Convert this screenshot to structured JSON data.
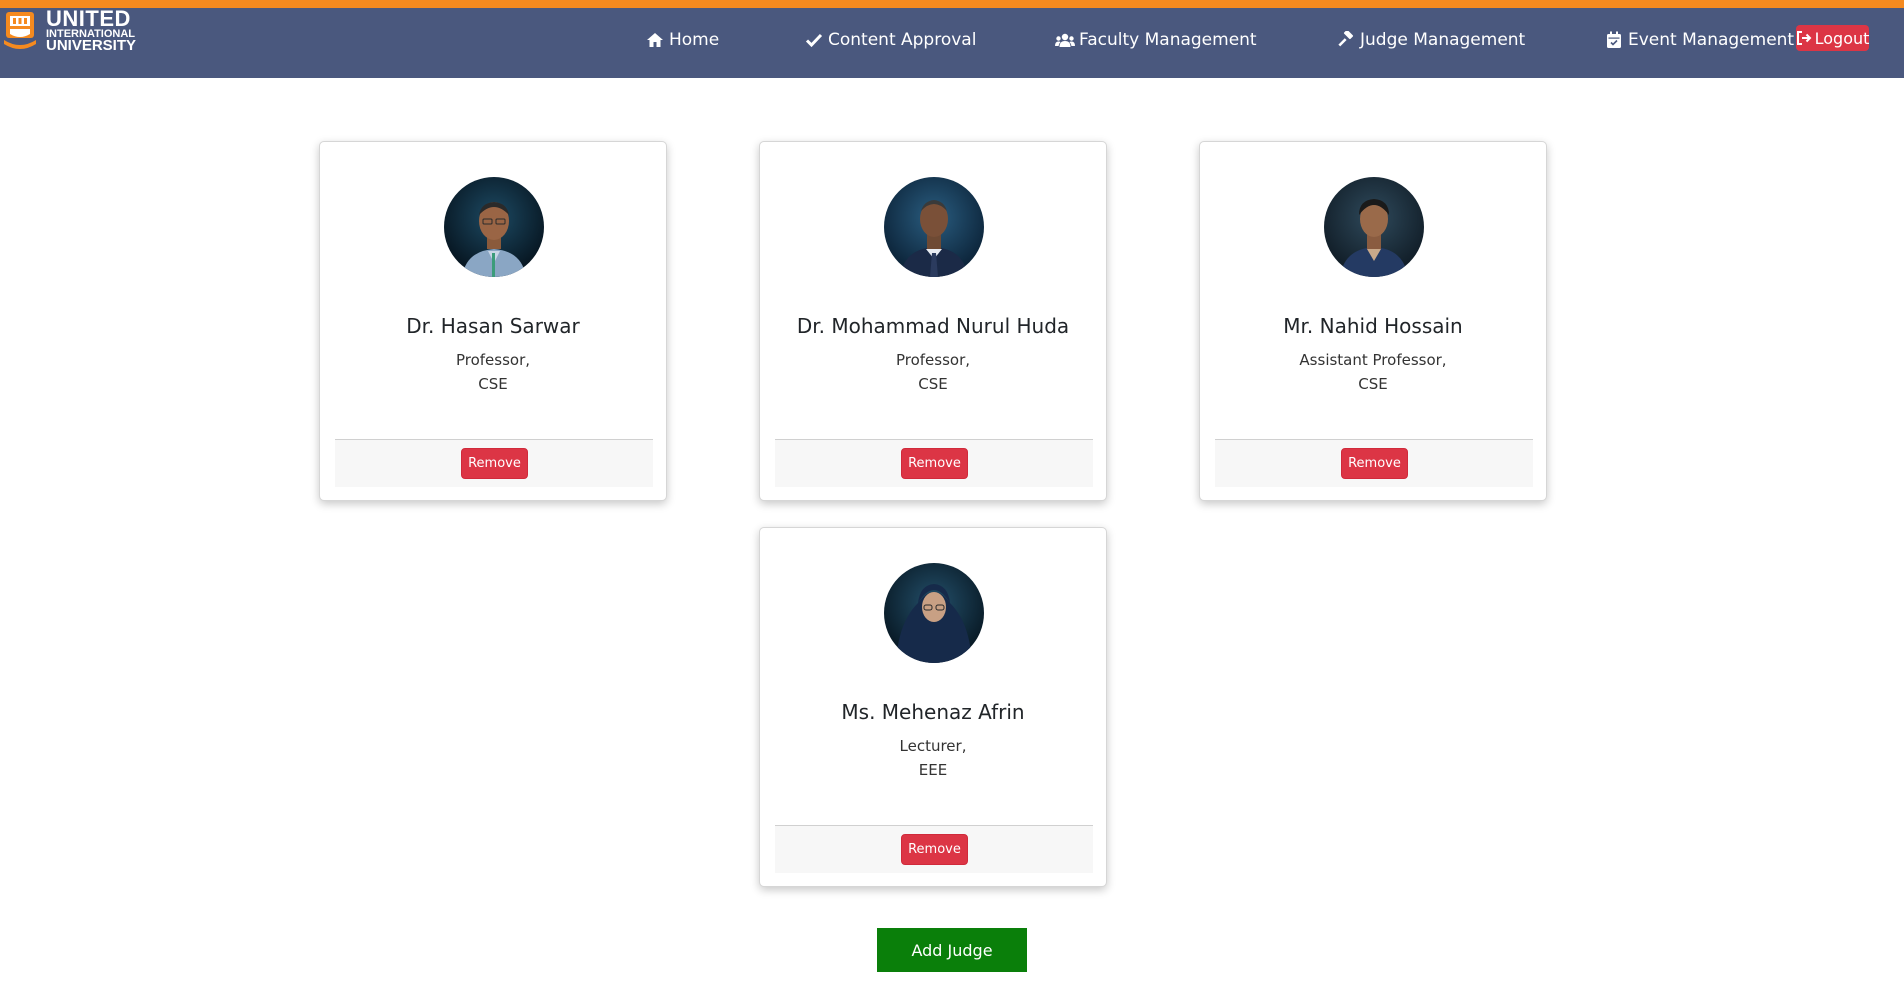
{
  "brand": {
    "line1": "UNITED",
    "line2": "INTERNATIONAL",
    "line3": "UNIVERSITY"
  },
  "nav": {
    "items": [
      {
        "label": "Home",
        "icon": "home-icon"
      },
      {
        "label": "Content Approval",
        "icon": "check-icon"
      },
      {
        "label": "Faculty Management",
        "icon": "users-icon"
      },
      {
        "label": "Judge Management",
        "icon": "gavel-icon"
      },
      {
        "label": "Event Management",
        "icon": "calendar-icon"
      }
    ],
    "logout_label": "Logout"
  },
  "judges": [
    {
      "name": "Dr. Hasan Sarwar",
      "role": "Professor,",
      "dept": "CSE",
      "remove_label": "Remove"
    },
    {
      "name": "Dr. Mohammad Nurul Huda",
      "role": "Professor,",
      "dept": "CSE",
      "remove_label": "Remove"
    },
    {
      "name": "Mr. Nahid Hossain",
      "role": "Assistant Professor,",
      "dept": "CSE",
      "remove_label": "Remove"
    },
    {
      "name": "Ms. Mehenaz Afrin",
      "role": "Lecturer,",
      "dept": "EEE",
      "remove_label": "Remove"
    }
  ],
  "add_judge_label": "Add Judge",
  "colors": {
    "top_accent": "#f58a1f",
    "navbar": "#4a587e",
    "danger": "#dc3545",
    "success": "#0a7f0a"
  }
}
